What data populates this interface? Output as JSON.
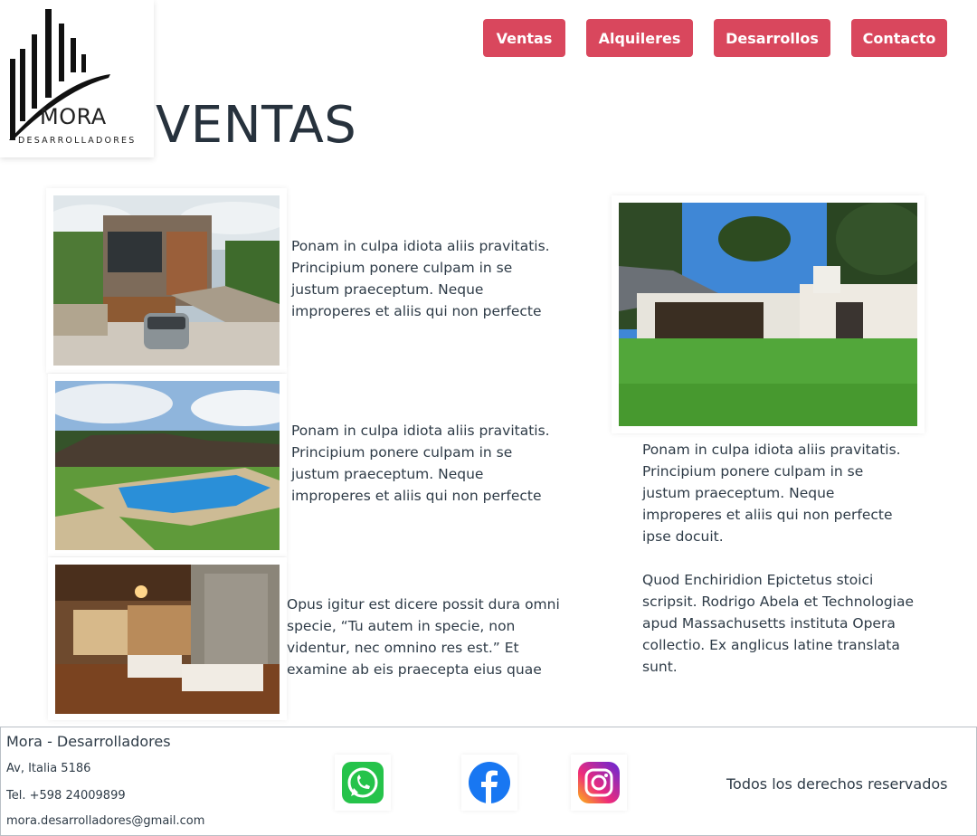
{
  "brand": {
    "name": "MORA",
    "sub": "DESARROLLADORES"
  },
  "nav": {
    "items": [
      "Ventas",
      "Alquileres",
      "Desarrollos",
      "Contacto"
    ]
  },
  "page": {
    "title": "VENTAS"
  },
  "listings": [
    {
      "text": "Ponam in culpa idiota aliis pravitatis. Principium ponere culpam in se justum praeceptum. Neque improperes et aliis qui non perfecte"
    },
    {
      "text": "Ponam in culpa idiota aliis pravitatis. Principium ponere culpam in se justum praeceptum. Neque improperes et aliis qui non perfecte"
    },
    {
      "text": "Opus igitur est dicere possit dura omni specie, “Tu autem in specie, non videntur, nec omnino res est.” Et examine ab eis praecepta eius quae"
    }
  ],
  "featured": {
    "text1": "Ponam in culpa idiota aliis pravitatis. Principium ponere culpam in se justum praeceptum. Neque improperes et aliis qui non perfecte ipse docuit.",
    "text2": "Quod Enchiridion Epictetus stoici scripsit. Rodrigo Abela et Technologiae apud Massachusetts instituta Opera collectio. Ex anglicus latine translata sunt."
  },
  "footer": {
    "company": "Mora - Desarrolladores",
    "address": "Av, Italia 5186",
    "phone": "Tel. +598 24009899",
    "email": "mora.desarrolladores@gmail.com",
    "rights": "Todos los derechos reservados",
    "social_icons": [
      "whatsapp-icon",
      "facebook-icon",
      "instagram-icon"
    ]
  },
  "colors": {
    "accent": "#d9475d",
    "text": "#2e3b47"
  }
}
